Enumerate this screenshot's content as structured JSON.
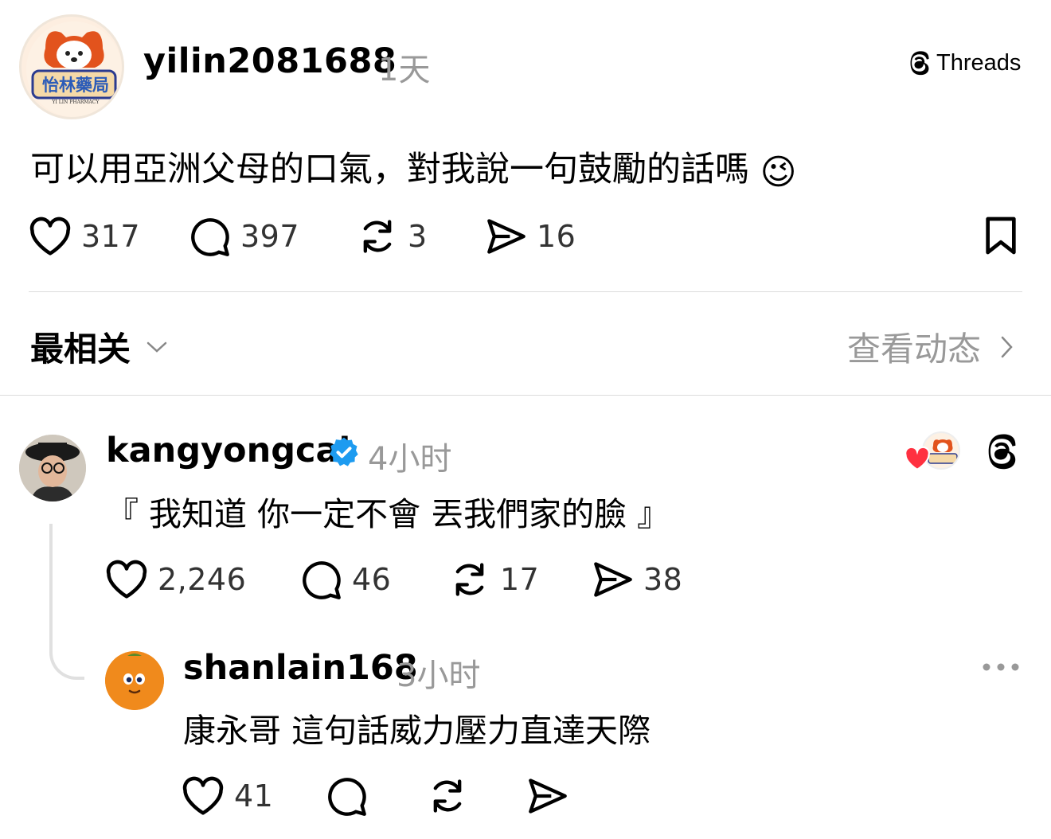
{
  "post": {
    "username": "yilin2081688",
    "time": "1天",
    "avatar_text": "怡林藥局",
    "avatar_subtext": "YI LIN PHARMACY",
    "brand_label": "Threads",
    "body": "可以用亞洲父母的口氣，對我說一句鼓勵的話嗎",
    "emoji": "😉",
    "stats": {
      "likes": "317",
      "replies": "397",
      "reposts": "3",
      "shares": "16"
    }
  },
  "sort": {
    "label": "最相关",
    "activity_link": "查看动态"
  },
  "comments": [
    {
      "username": "kangyongcai",
      "verified": true,
      "time": "4小时",
      "body": "『 我知道 你一定不會 丟我們家的臉 』",
      "stats": {
        "likes": "2,246",
        "replies": "46",
        "reposts": "17",
        "shares": "38"
      }
    },
    {
      "username": "shanlain168",
      "time": "3小时",
      "body": "康永哥 這句話威力壓力直達天際",
      "stats": {
        "likes": "41"
      }
    }
  ],
  "colors": {
    "text": "#000000",
    "secondary": "#999999",
    "divider": "#dcdcdc",
    "verified": "#1d9bf0",
    "heart": "#ff3040",
    "orange_avatar": "#f08a1c"
  },
  "icons": [
    "heart-icon",
    "comment-icon",
    "repost-icon",
    "share-icon",
    "bookmark-icon",
    "threads-icon",
    "chevron-down-icon",
    "chevron-right-icon",
    "verified-icon",
    "more-icon"
  ]
}
